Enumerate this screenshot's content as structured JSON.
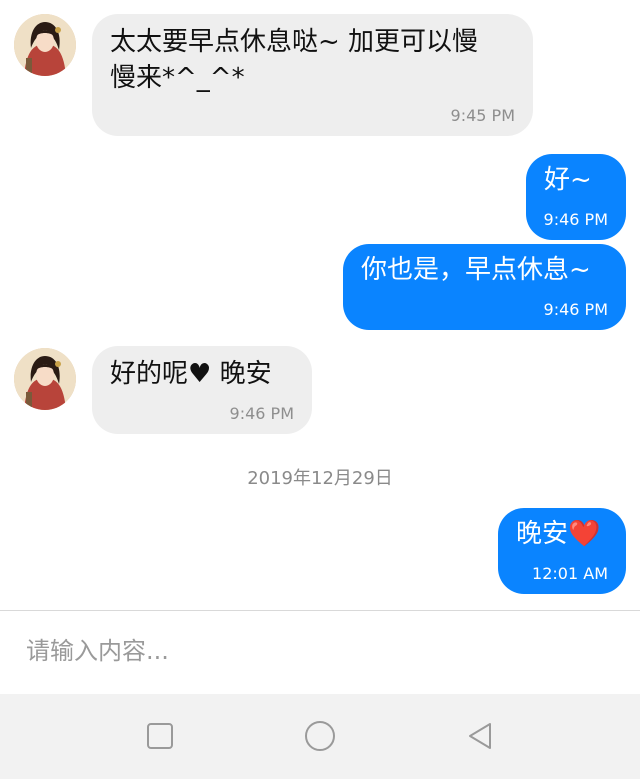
{
  "messages": [
    {
      "direction": "incoming",
      "text": "太太要早点休息哒~ 加更可以慢\n慢来*^_^*",
      "time": "9:45 PM"
    },
    {
      "direction": "outgoing",
      "text": "好~",
      "time": "9:46 PM"
    },
    {
      "direction": "outgoing",
      "text": "你也是，早点休息~",
      "time": "9:46 PM"
    },
    {
      "direction": "incoming",
      "text": "好的呢♥ 晚安",
      "time": "9:46 PM"
    },
    {
      "direction": "outgoing",
      "text": "晚安❤️",
      "time": "12:01 AM"
    }
  ],
  "date_separator": "2019年12月29日",
  "composer": {
    "placeholder": "请输入内容..."
  },
  "nav": {
    "icons": [
      "square-recents-icon",
      "circle-home-icon",
      "triangle-back-icon"
    ]
  },
  "colors": {
    "incoming_bubble": "#eeeeee",
    "outgoing_bubble": "#0a84ff",
    "nav_background": "#f2f2f2"
  }
}
